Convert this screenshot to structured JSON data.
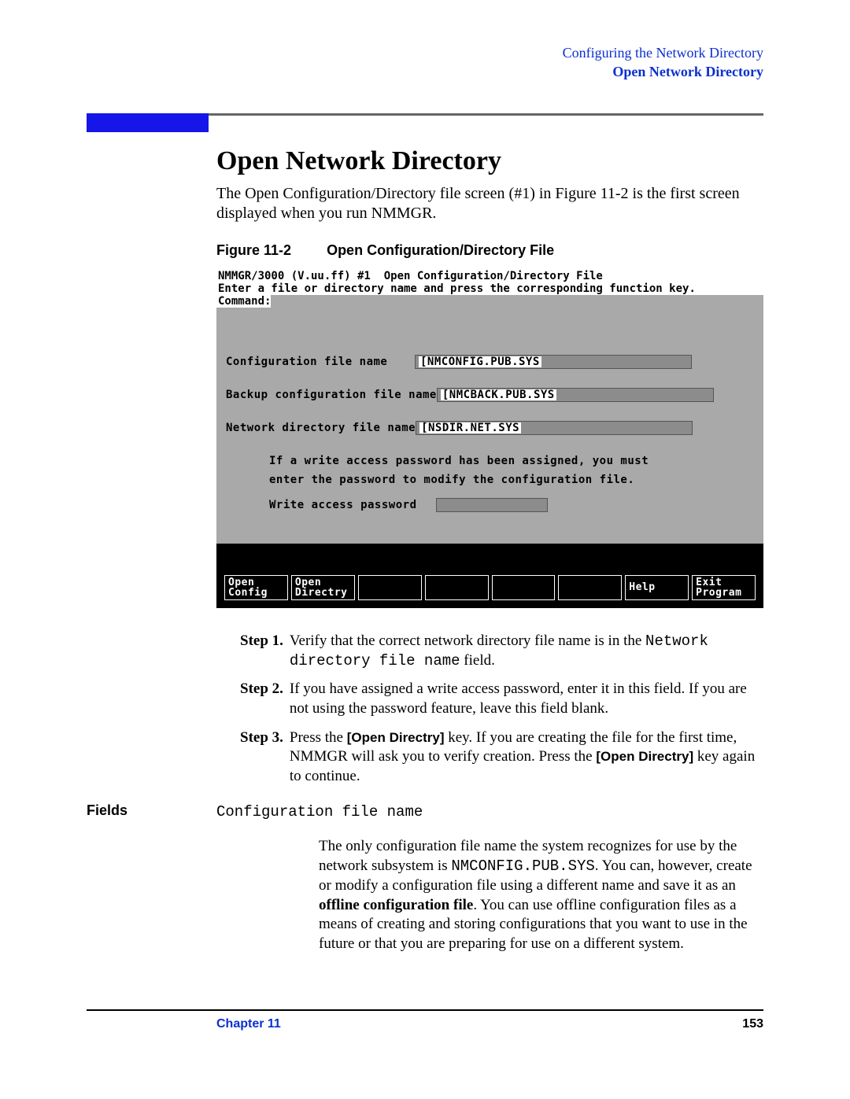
{
  "header": {
    "line1": "Configuring the Network Directory",
    "line2": "Open Network Directory"
  },
  "section_title": "Open Network Directory",
  "intro": "The Open Configuration/Directory file screen (#1) in Figure 11-2 is the first screen displayed when you run NMMGR.",
  "figure": {
    "num": "Figure 11-2",
    "title": "Open Configuration/Directory File"
  },
  "terminal": {
    "title_bar": "NMMGR/3000 (V.uu.ff) #1  Open Configuration/Directory File",
    "hint": "Enter a file or directory name and press the corresponding function key.",
    "command_label": "Command:",
    "rows": {
      "config_label": "Configuration file name",
      "config_value": "[NMCONFIG.PUB.SYS",
      "backup_label": "Backup configuration file name",
      "backup_value": "[NMCBACK.PUB.SYS",
      "netdir_label": "Network directory file name",
      "netdir_value": "[NSDIR.NET.SYS"
    },
    "note1": "If a write access password has been assigned, you must",
    "note2": "enter the password to modify the configuration file.",
    "pwd_label": "Write access password",
    "softkeys": [
      {
        "l1": "Open",
        "l2": "Config"
      },
      {
        "l1": "Open",
        "l2": "Directry"
      },
      {
        "l1": "",
        "l2": ""
      },
      {
        "l1": "",
        "l2": ""
      },
      {
        "l1": "",
        "l2": ""
      },
      {
        "l1": "",
        "l2": ""
      },
      {
        "l1": "Help",
        "l2": ""
      },
      {
        "l1": "Exit",
        "l2": "Program"
      }
    ]
  },
  "steps": {
    "s1label": "Step 1.",
    "s1a": "Verify that the correct network directory file name is in the ",
    "s1b": "Network directory file name",
    "s1c": " field.",
    "s2label": "Step 2.",
    "s2": "If you have assigned a write access password, enter it in this field. If you are not using the password feature, leave this field blank.",
    "s3label": "Step 3.",
    "s3a": "Press the ",
    "s3b": "[Open Directry]",
    "s3c": " key. If you are creating the file for the first time, NMMGR will ask you to verify creation. Press the ",
    "s3d": "[Open Directry]",
    "s3e": " key again to continue."
  },
  "fields": {
    "heading": "Fields",
    "name": "Configuration file name",
    "desc_a": "The only configuration file name the system recognizes for use by the network subsystem is ",
    "desc_b": "NMCONFIG.PUB.SYS",
    "desc_c": ". You can, however, create or modify a configuration file using a different name and save it as an ",
    "desc_d": "offline configuration file",
    "desc_e": ". You can use offline configuration files as a means of creating and storing configurations that you want to use in the future or that you are preparing for use on a different system."
  },
  "footer": {
    "chapter": "Chapter 11",
    "page": "153"
  }
}
